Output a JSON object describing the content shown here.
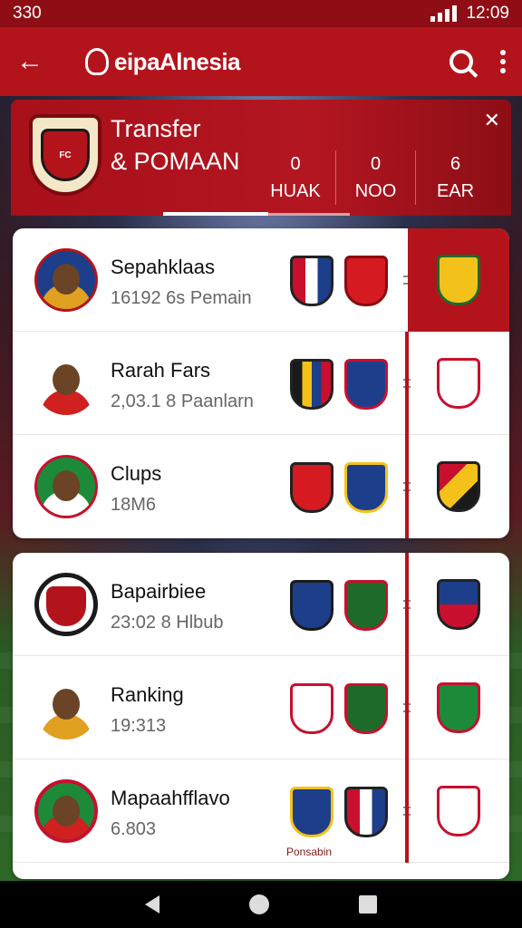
{
  "status_bar": {
    "time_left": "330",
    "time_right": "12:09"
  },
  "app_bar": {
    "title": "eipaAlnesia"
  },
  "header": {
    "title_line1": "Transfer",
    "title_line2": "& POMAAN",
    "stats": [
      {
        "value": "0",
        "label": "HUAK"
      },
      {
        "value": "0",
        "label": "NOO"
      },
      {
        "value": "6",
        "label": "EAR"
      }
    ]
  },
  "card1": {
    "rows": [
      {
        "name": "Sepahklaas",
        "sub": "16192 6s Pemain"
      },
      {
        "name": "Rarah Fars",
        "sub": "2,03.1 8 Paanlarn"
      },
      {
        "name": "Clups",
        "sub": "18M6"
      }
    ]
  },
  "card2": {
    "rows": [
      {
        "name": "Bapairbiee",
        "sub": "23:02 8 Hlbub"
      },
      {
        "name": "Ranking",
        "sub": "19:313"
      },
      {
        "name": "Mapaahfflavo",
        "sub": "6.803"
      }
    ],
    "footer_label": "Ponsabin"
  },
  "colors": {
    "primary": "#b3141c",
    "dark": "#8f0d14"
  }
}
